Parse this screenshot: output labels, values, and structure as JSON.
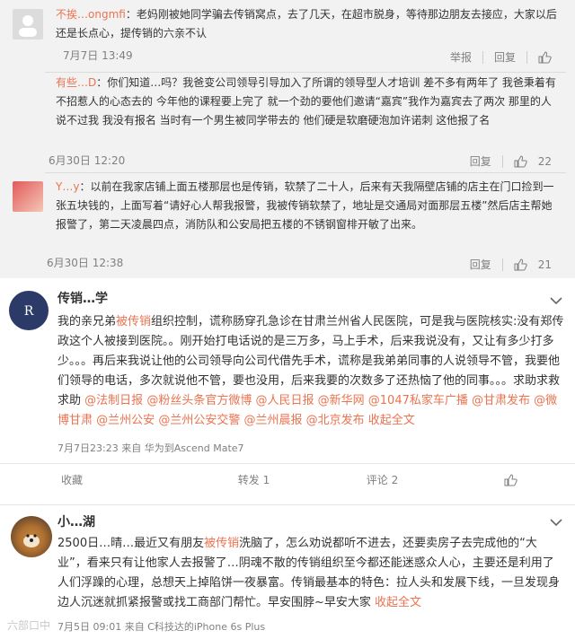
{
  "comments": [
    {
      "name": "不挨…ongmfi",
      "text": "：老妈刚被她同学骗去传销窝点，去了几天，在超市脱身，等待那边朋友去接应，大家以后还是长点心，提传销的六亲不认",
      "time": "7月7日 13:49",
      "report": "举报",
      "reply": "回复",
      "likes": ""
    },
    {
      "name": "有些…D",
      "text": "：你们知道…吗？我爸变公司领导引导加入了所谓的领导型人才培训 差不多有两年了 我爸秉着有不招惹人的心态去的 今年他的课程要上完了 就一个劲的要他们邀请“嘉宾”我作为嘉宾去了两次 那里的人说不过我 我没有报名 当时有一个男生被同学带去的 他们硬是软磨硬泡加许诺刺 这他报了名",
      "time": "6月30日 12:20",
      "report": "",
      "reply": "回复",
      "likes": "22"
    },
    {
      "name": "Y…y",
      "text": "：以前在我家店铺上面五楼那层也是传销，软禁了二十人，后来有天我隔壁店铺的店主在门口捡到一张五块钱的，上面写着“请好心人帮我报警，我被传销软禁了，地址是交通局对面那层五楼”然后店主帮她报警了，第二天凌晨四点，消防队和公安局把五楼的不锈钢窗棑开敏了出来。",
      "time": "6月30日 12:38",
      "report": "",
      "reply": "回复",
      "likes": "21"
    }
  ],
  "post1": {
    "author": "传销…学",
    "text_a": "我的亲兄弟",
    "keyword": "被传销",
    "text_b": "组织控制，谎称肠穿孔急诊在甘肃兰州省人民医院，可是我与医院核实:没有郑传政这个人被接到医院。。刚开始打电话说的是三万多，马上手术，后来我说没有，又让有多少打多少。。。再后来我说让他的公司领导向公司代借先手术，谎称是我弟弟同事的人说领导不管，我要他们领导的电话，多次就说他不管，要也没用，后来我要的次数多了还热恼了他的同事。。。求助求救求助",
    "tags": [
      "@法制日报",
      "@粉丝头条官方微博",
      "@人民日报",
      "@新华网",
      "@1047私家车广播",
      "@甘肃发布",
      "@微博甘肃",
      "@兰州公安",
      "@兰州公安交警",
      "@兰州晨报",
      "@北京发布"
    ],
    "collapse": "收起全文",
    "meta": "7月7日23:23 来自 华为到Ascend Mate7",
    "bar": [
      "收藏",
      "转发 1",
      "评论 2",
      "赞"
    ]
  },
  "post2": {
    "author": "小…湖",
    "text_a": "2500日…晴…最近又有朋友",
    "keyword": "被传销",
    "text_b": "洗脑了，怎么劝说都听不进去，还要卖房子去完成他的“大业”，看来只有让他家人去报警了…阴魂不散的传销组织至今都还能迷惑众人心，主要还是利用了人们浮躁的心理，总想天上掉陷饼一夜暴富。传销最基本的特色：拉人头和发展下线，一旦发现身边人沉迷就抓紧报警或找工商部门帮忙。早安围脖~早安大家",
    "collapse": "收起全文",
    "meta": "7月5日 09:01 来自 C科技达的iPhone 6s Plus"
  },
  "watermark": "六部口中"
}
